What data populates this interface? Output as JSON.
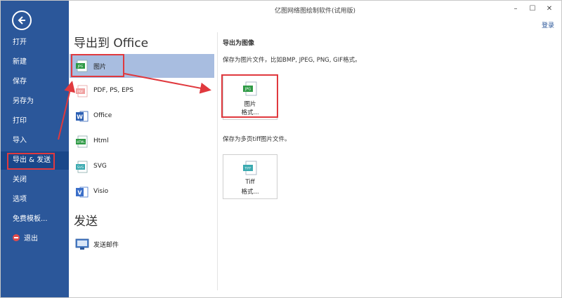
{
  "window": {
    "title": "亿图网络图绘制软件(试用版)",
    "minimize_label": "–",
    "maximize_label": "☐",
    "close_label": "✕",
    "login_label": "登录"
  },
  "sidebar": {
    "items": [
      {
        "label": "打开"
      },
      {
        "label": "新建"
      },
      {
        "label": "保存"
      },
      {
        "label": "另存为"
      },
      {
        "label": "打印"
      },
      {
        "label": "导入"
      },
      {
        "label": "导出 & 发送"
      },
      {
        "label": "关闭"
      },
      {
        "label": "选项"
      },
      {
        "label": "免费模板..."
      },
      {
        "label": "退出"
      }
    ],
    "active_index": 6
  },
  "middle": {
    "export_heading": "导出到 Office",
    "export_items": [
      {
        "label": "图片",
        "icon": "jpg-image-icon",
        "icon_text": "JPG"
      },
      {
        "label": "PDF, PS, EPS",
        "icon": "pdf-file-icon",
        "icon_text": "PDF"
      },
      {
        "label": "Office",
        "icon": "word-icon",
        "icon_text": "W"
      },
      {
        "label": "Html",
        "icon": "html-icon",
        "icon_text": "HTML"
      },
      {
        "label": "SVG",
        "icon": "svg-icon",
        "icon_text": "SVG"
      },
      {
        "label": "Visio",
        "icon": "visio-icon",
        "icon_text": "V"
      }
    ],
    "send_heading": "发送",
    "send_items": [
      {
        "label": "发送邮件",
        "icon": "email-send-icon"
      }
    ]
  },
  "right": {
    "section_title": "导出为图像",
    "desc1": "保存为图片文件，比如BMP, JPEG, PNG, GIF格式。",
    "image_button": {
      "line1": "图片",
      "line2": "格式...",
      "icon_text": "JPG"
    },
    "desc2": "保存为多页tiff图片文件。",
    "tiff_button": {
      "line1": "Tiff",
      "line2": "格式...",
      "icon_text": "TIFF"
    }
  },
  "colors": {
    "sidebar_bg": "#2b579a",
    "sidebar_active": "#19478a",
    "selected_item": "#a8bde0",
    "highlight": "#e0393e",
    "jpg_green": "#2e9a45",
    "pdf_red": "#e06060",
    "word_blue": "#2b5fb4",
    "svg_teal": "#3aaab0",
    "visio_blue": "#3b6fc9"
  }
}
